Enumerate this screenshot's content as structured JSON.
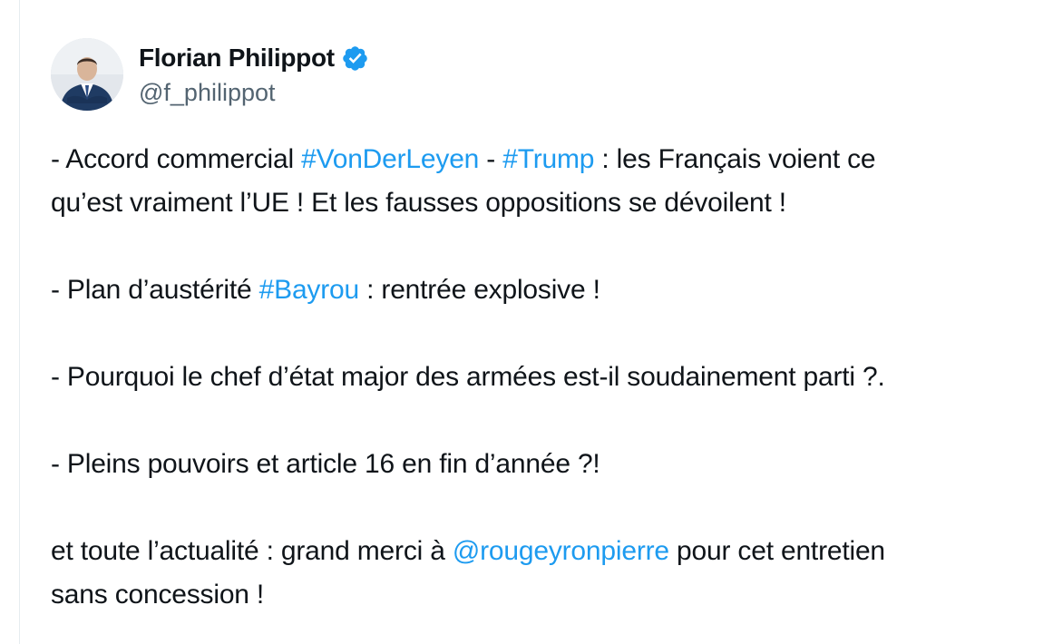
{
  "author": {
    "display_name": "Florian Philippot",
    "handle": "@f_philippot",
    "verified_icon": "verified-badge-icon",
    "accent_color": "#1d9bf0"
  },
  "tweet": {
    "p1": {
      "s1": "- Accord commercial ",
      "tag1": "#VonDerLeyen",
      "s2": " - ",
      "tag2": "#Trump",
      "s3": " : les Français voient ce",
      "line2": "qu’est vraiment l’UE ! Et les fausses oppositions se dévoilent !"
    },
    "p2": {
      "s1": "- Plan d’austérité ",
      "tag1": "#Bayrou",
      "s2": " : rentrée explosive !"
    },
    "p3": {
      "s1": "- Pourquoi le chef d’état major des armées est-il soudainement parti ?."
    },
    "p4": {
      "s1": "- Pleins pouvoirs et article 16 en fin d’année ?!"
    },
    "p5": {
      "s1": "et toute l’actualité : grand merci à ",
      "mention": "@rougeyronpierre",
      "s2": " pour cet entretien",
      "line2": "sans concession !"
    }
  }
}
